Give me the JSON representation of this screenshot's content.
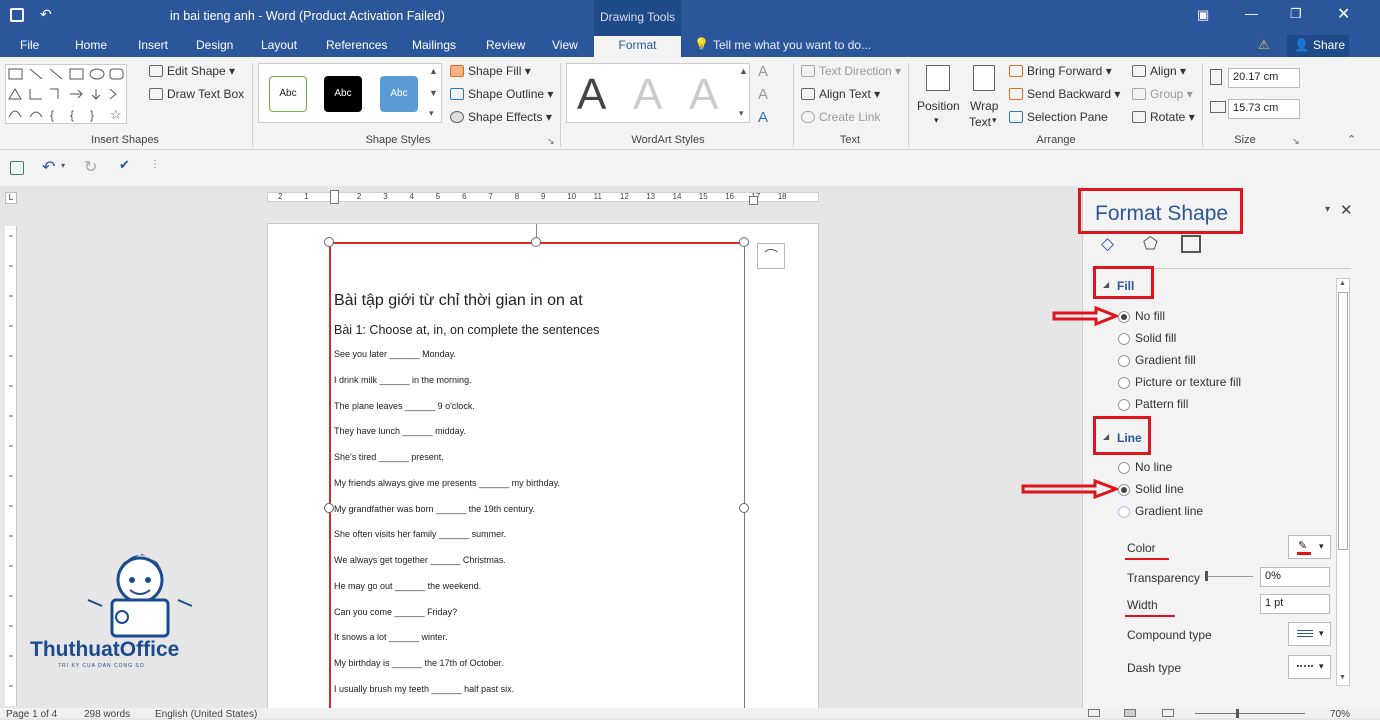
{
  "window": {
    "title": "in bai tieng anh - Word (Product Activation Failed)",
    "context_tab": "Drawing Tools",
    "tell_me": "Tell me what you want to do...",
    "share": "Share"
  },
  "tabs": [
    "File",
    "Home",
    "Insert",
    "Design",
    "Layout",
    "References",
    "Mailings",
    "Review",
    "View",
    "Format"
  ],
  "active_tab": "Format",
  "ribbon": {
    "insert_shapes": {
      "edit_shape": "Edit Shape",
      "draw_text_box": "Draw Text Box",
      "label": "Insert Shapes"
    },
    "shape_styles": {
      "swatches": [
        "Abc",
        "Abc",
        "Abc"
      ],
      "shape_fill": "Shape Fill",
      "shape_outline": "Shape Outline",
      "shape_effects": "Shape Effects",
      "label": "Shape Styles"
    },
    "wordart": {
      "letters": [
        "A",
        "A",
        "A"
      ],
      "label": "WordArt Styles"
    },
    "text": {
      "text_direction": "Text Direction",
      "align_text": "Align Text",
      "create_link": "Create Link",
      "label": "Text"
    },
    "arrange": {
      "position": "Position",
      "wrap_text_1": "Wrap",
      "wrap_text_2": "Text",
      "bring_forward": "Bring Forward",
      "send_backward": "Send Backward",
      "selection_pane": "Selection Pane",
      "align": "Align",
      "group": "Group",
      "rotate": "Rotate",
      "label": "Arrange"
    },
    "size": {
      "height": "20.17 cm",
      "width": "15.73 cm",
      "label": "Size"
    }
  },
  "document": {
    "title": "Bài tập giới từ chỉ thời gian in on at",
    "subtitle": "Bài 1: Choose at, in, on complete the sentences",
    "lines": [
      "See you later ______ Monday.",
      "I drink milk ______ in the morning.",
      "The plane leaves ______ 9 o'clock.",
      "They have lunch ______ midday.",
      "She's tired ______ present.",
      "My friends always give me presents ______ my birthday.",
      "My grandfather was born ______ the 19th century.",
      "She often visits her family ______ summer.",
      "We always get together ______ Christmas.",
      "He may go out ______ the weekend.",
      "Can you come ______ Friday?",
      "It snows a lot ______ winter.",
      "My birthday is ______ the 17th of October.",
      "I usually brush my teeth ______ half past six."
    ],
    "ruler_numbers": [
      "2",
      "1",
      "1",
      "2",
      "3",
      "4",
      "5",
      "6",
      "7",
      "8",
      "9",
      "10",
      "11",
      "12",
      "13",
      "14",
      "15",
      "16",
      "17",
      "18"
    ]
  },
  "panel": {
    "title": "Format Shape",
    "fill": {
      "label": "Fill",
      "options": [
        "No fill",
        "Solid fill",
        "Gradient fill",
        "Picture or texture fill",
        "Pattern fill"
      ],
      "selected": "No fill"
    },
    "line": {
      "label": "Line",
      "options": [
        "No line",
        "Solid line",
        "Gradient line"
      ],
      "selected": "Solid line",
      "color_label": "Color",
      "transparency_label": "Transparency",
      "transparency_value": "0%",
      "width_label": "Width",
      "width_value": "1 pt",
      "compound_label": "Compound type",
      "dash_label": "Dash type"
    }
  },
  "watermark": {
    "brand": "ThuthuatOffice",
    "tagline": "TRI KY CUA DAN CONG SO"
  },
  "status": {
    "page": "Page 1 of 4",
    "words": "298 words",
    "language": "English (United States)",
    "zoom": "70%"
  },
  "colors": {
    "word_blue": "#2b579a",
    "annotation_red": "#e0141c",
    "panel_title": "#2b579a"
  }
}
